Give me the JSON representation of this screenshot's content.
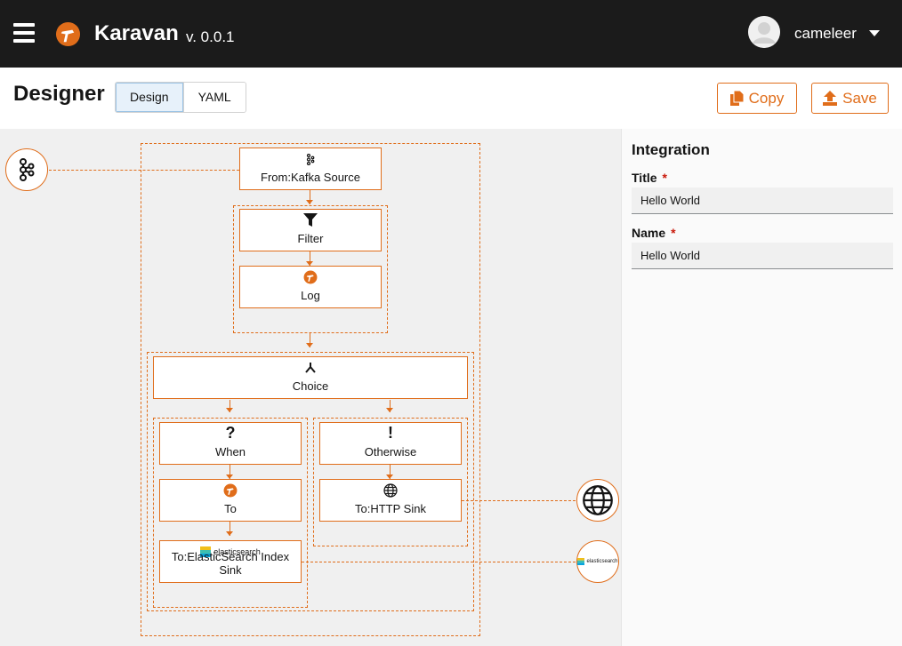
{
  "header": {
    "brand": "Karavan",
    "version": "v. 0.0.1",
    "username": "cameleer"
  },
  "toolbar": {
    "title": "Designer",
    "tabs": [
      {
        "label": "Design",
        "active": true
      },
      {
        "label": "YAML",
        "active": false
      }
    ],
    "copy_label": "Copy",
    "save_label": "Save",
    "accent_color": "#e06d1a"
  },
  "flow": {
    "from": "From:Kafka Source",
    "filter": "Filter",
    "log": "Log",
    "choice": "Choice",
    "when": "When",
    "to": "To",
    "to_elastic": "To:ElasticSearch Index Sink",
    "elastic_logo_text": "elasticsearch",
    "otherwise": "Otherwise",
    "to_http": "To:HTTP Sink"
  },
  "properties": {
    "heading": "Integration",
    "fields": [
      {
        "label": "Title",
        "required_mark": "*",
        "value": "Hello World"
      },
      {
        "label": "Name",
        "required_mark": "*",
        "value": "Hello World"
      }
    ]
  }
}
